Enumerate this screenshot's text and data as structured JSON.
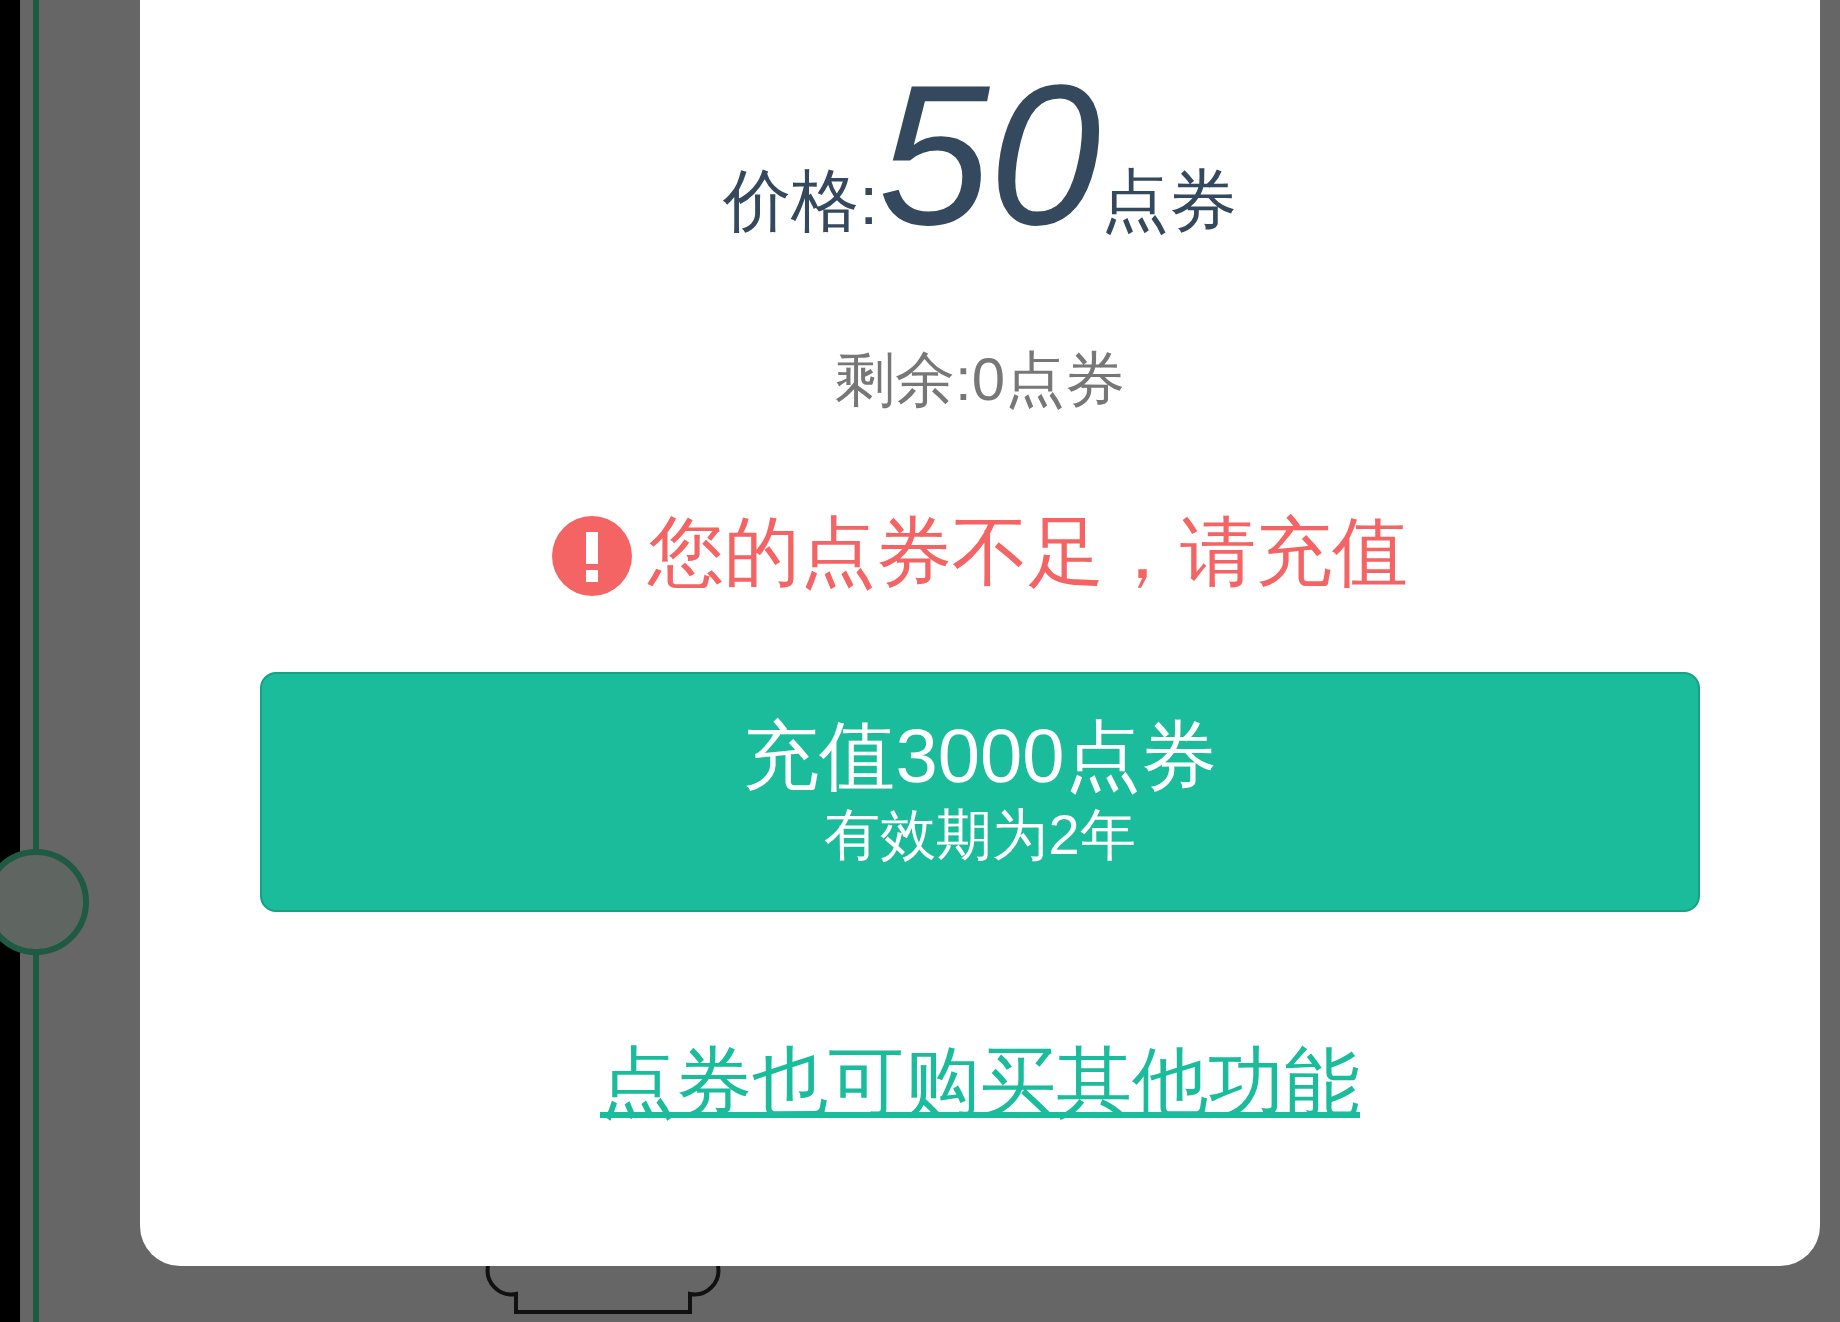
{
  "dialog": {
    "price": {
      "label": "价格:",
      "value": "50",
      "unit": "点券"
    },
    "balance": "剩余:0点券",
    "warning": {
      "text": "您的点券不足，请充值"
    },
    "recharge_button": {
      "title": "充值3000点券",
      "subtitle": "有效期为2年"
    },
    "link": "点券也可购买其他功能"
  }
}
